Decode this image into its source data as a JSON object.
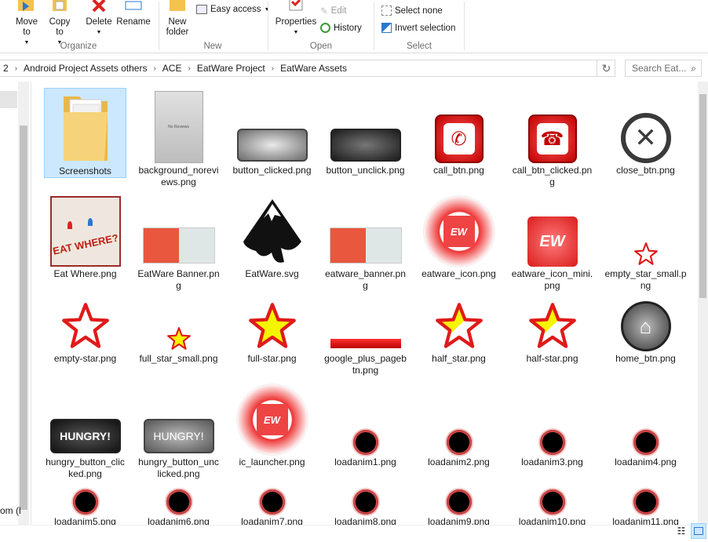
{
  "ribbon": {
    "move_to": "Move to",
    "copy_to": "Copy to",
    "delete": "Delete",
    "rename": "Rename",
    "organize": "Organize",
    "new_folder": "New folder",
    "easy_access": "Easy access",
    "new_group": "New",
    "properties": "Properties",
    "edit": "Edit",
    "history": "History",
    "open_group": "Open",
    "select_none": "Select none",
    "invert_selection": "Invert selection",
    "select_group": "Select"
  },
  "address": {
    "breadcrumbs": [
      "2",
      "Android Project Assets others",
      "ACE",
      "EatWare Project",
      "EatWare Assets"
    ],
    "search_placeholder": "Search Eat..."
  },
  "left_pane": {
    "partial_text": "om (l"
  },
  "files": [
    {
      "name": "Screenshots",
      "thumb": "folder"
    },
    {
      "name": "background_noreviews.png",
      "thumb": "doc"
    },
    {
      "name": "button_clicked.png",
      "thumb": "btn-gray"
    },
    {
      "name": "button_unclick.png",
      "thumb": "btn-dark"
    },
    {
      "name": "call_btn.png",
      "thumb": "call"
    },
    {
      "name": "call_btn_clicked.png",
      "thumb": "call2"
    },
    {
      "name": "close_btn.png",
      "thumb": "close"
    },
    {
      "name": "Eat Where.png",
      "thumb": "map"
    },
    {
      "name": "EatWare Banner.png",
      "thumb": "banner"
    },
    {
      "name": "EatWare.svg",
      "thumb": "inkscape"
    },
    {
      "name": "eatware_banner.png",
      "thumb": "banner"
    },
    {
      "name": "eatware_icon.png",
      "thumb": "ew-ring"
    },
    {
      "name": "eatware_icon_mini.png",
      "thumb": "ew-mini"
    },
    {
      "name": "empty_star_small.png",
      "thumb": "star-empty-s"
    },
    {
      "name": "empty-star.png",
      "thumb": "star-empty"
    },
    {
      "name": "full_star_small.png",
      "thumb": "star-full-s"
    },
    {
      "name": "full-star.png",
      "thumb": "star-full"
    },
    {
      "name": "google_plus_pagebtn.png",
      "thumb": "gplus"
    },
    {
      "name": "half_star.png",
      "thumb": "star-half"
    },
    {
      "name": "half-star.png",
      "thumb": "star-half"
    },
    {
      "name": "home_btn.png",
      "thumb": "home"
    },
    {
      "name": "hungry_button_clicked.png",
      "thumb": "hungry-dark",
      "label": "HUNGRY!"
    },
    {
      "name": "hungry_button_unclicked.png",
      "thumb": "hungry-gray",
      "label": "HUNGRY!"
    },
    {
      "name": "ic_launcher.png",
      "thumb": "ew-ring"
    },
    {
      "name": "loadanim1.png",
      "thumb": "dot"
    },
    {
      "name": "loadanim2.png",
      "thumb": "dot"
    },
    {
      "name": "loadanim3.png",
      "thumb": "dot"
    },
    {
      "name": "loadanim4.png",
      "thumb": "dot"
    },
    {
      "name": "loadanim5.png",
      "thumb": "dot"
    },
    {
      "name": "loadanim6.png",
      "thumb": "dot"
    },
    {
      "name": "loadanim7.png",
      "thumb": "dot"
    },
    {
      "name": "loadanim8.png",
      "thumb": "dot"
    },
    {
      "name": "loadanim9.png",
      "thumb": "dot"
    },
    {
      "name": "loadanim10.png",
      "thumb": "dot"
    },
    {
      "name": "loadanim11.png",
      "thumb": "dot"
    }
  ],
  "thumb_text": {
    "ew": "EW",
    "eat_where": "EAT WHERE?",
    "no_reviews": "No Reviews"
  }
}
